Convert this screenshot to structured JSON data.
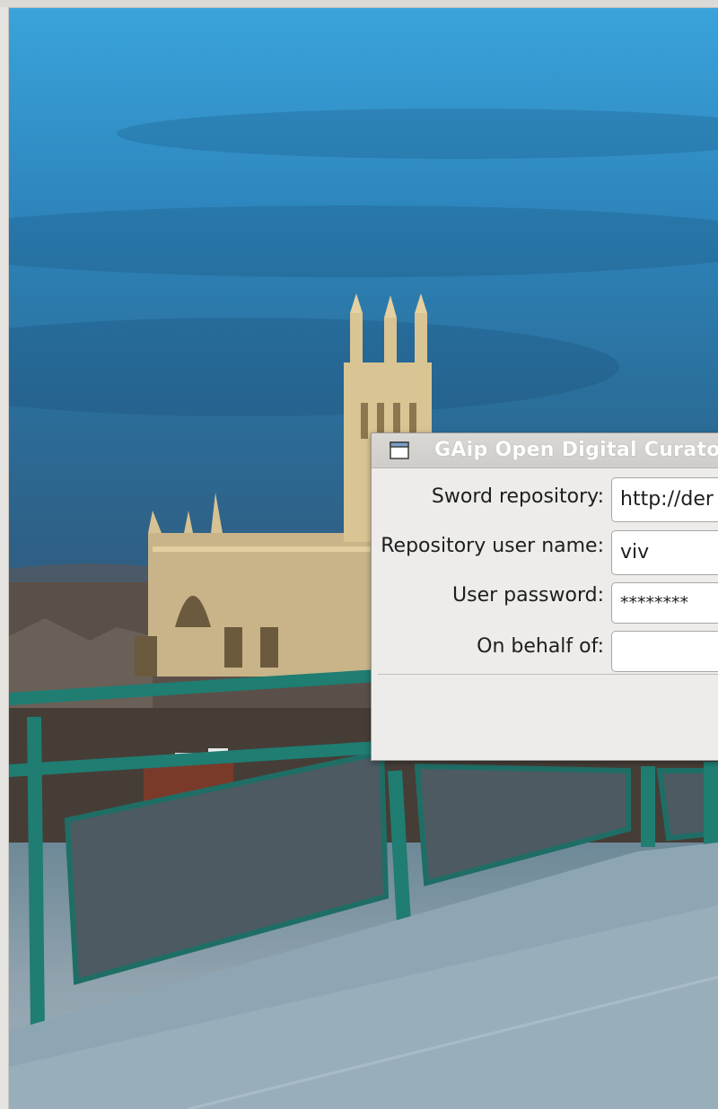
{
  "dialog": {
    "title": "GAip Open Digital Curato",
    "fields": [
      {
        "label": "Sword repository:",
        "value": "http://der"
      },
      {
        "label": "Repository user name:",
        "value": "viv"
      },
      {
        "label": "User password:",
        "value": "********"
      },
      {
        "label": "On behalf of:",
        "value": ""
      }
    ]
  }
}
